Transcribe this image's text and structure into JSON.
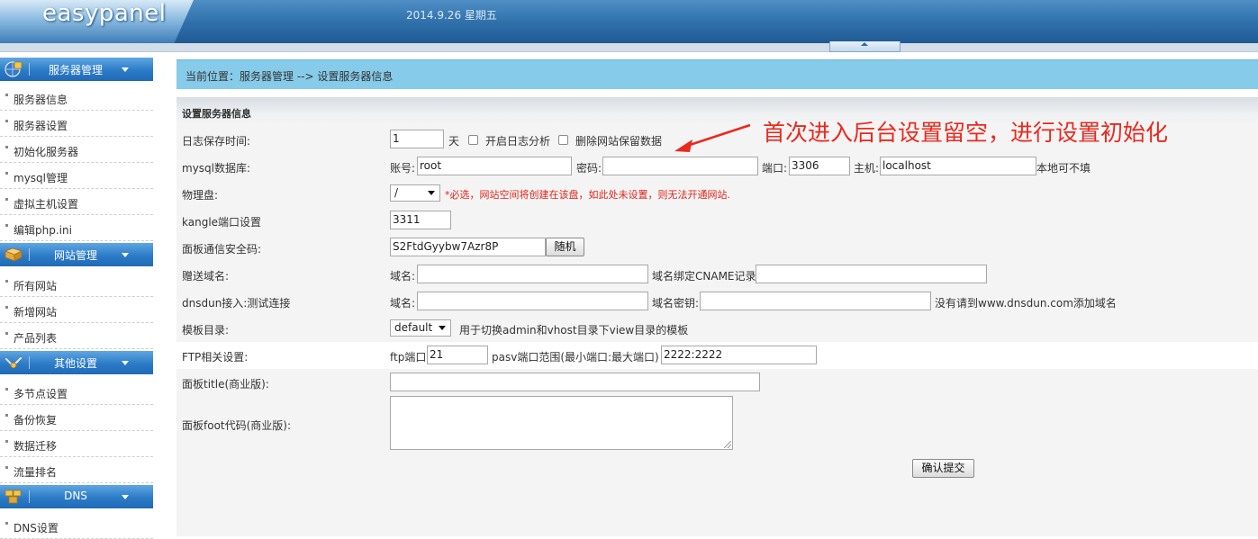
{
  "header": {
    "logo": "easypanel",
    "date": "2014.9.26 星期五"
  },
  "sidebar": {
    "groups": [
      {
        "title": "服务器管理",
        "icon": "server-globe-icon",
        "items": [
          "服务器信息",
          "服务器设置",
          "初始化服务器",
          "mysql管理",
          "虚拟主机设置",
          "编辑php.ini"
        ]
      },
      {
        "title": "网站管理",
        "icon": "book-icon",
        "items": [
          "所有网站",
          "新增网站",
          "产品列表"
        ]
      },
      {
        "title": "其他设置",
        "icon": "tools-icon",
        "items": [
          "多节点设置",
          "备份恢复",
          "数据迁移",
          "流量排名"
        ]
      },
      {
        "title": "DNS",
        "icon": "dns-blocks-icon",
        "items": [
          "DNS设置"
        ]
      }
    ]
  },
  "breadcrumb": "当前位置：服务器管理 --> 设置服务器信息",
  "form": {
    "title": "设置服务器信息",
    "log_days": {
      "label": "日志保存时间:",
      "value": "1",
      "unit": "天",
      "enable_analysis": "开启日志分析",
      "delete_site_data": "删除网站保留数据"
    },
    "mysql": {
      "label": "mysql数据库:",
      "account_label": "账号:",
      "account": "root",
      "password_label": "密码:",
      "password": "",
      "port_label": "端口:",
      "port": "3306",
      "host_label": "主机:",
      "host": "localhost",
      "note": "本地可不填"
    },
    "disk": {
      "label": "物理盘:",
      "selected": "/",
      "warning": "*必选，网站空间将创建在该盘，如此处未设置，则无法开通网站."
    },
    "kangle_port": {
      "label": "kangle端口设置",
      "value": "3311"
    },
    "security_code": {
      "label": "面板通信安全码:",
      "value": "S2FtdGyybw7Azr8P",
      "random_button": "随机"
    },
    "gift_domain": {
      "label": "赠送域名:",
      "domain_label": "域名:",
      "domain": "",
      "cname_label": "域名绑定CNAME记录",
      "cname": ""
    },
    "dnsdun": {
      "label": "dnsdun接入:测试连接",
      "domain_label": "域名:",
      "domain": "",
      "key_label": "域名密钥:",
      "key": "",
      "note": "没有请到www.dnsdun.com添加域名"
    },
    "template": {
      "label": "模板目录:",
      "selected": "default",
      "note": "用于切换admin和vhost目录下view目录的模板"
    },
    "ftp": {
      "label": "FTP相关设置:",
      "port_label": "ftp端口",
      "port": "21",
      "pasv_label": "pasv端口范围(最小端口:最大端口)",
      "pasv": "2222:2222"
    },
    "panel_title": {
      "label": "面板title(商业版):",
      "value": ""
    },
    "panel_foot": {
      "label": "面板foot代码(商业版):",
      "value": ""
    },
    "submit": "确认提交"
  },
  "annotation": {
    "text": "首次进入后台设置留空，进行设置初始化",
    "color": "#e82a1f"
  }
}
